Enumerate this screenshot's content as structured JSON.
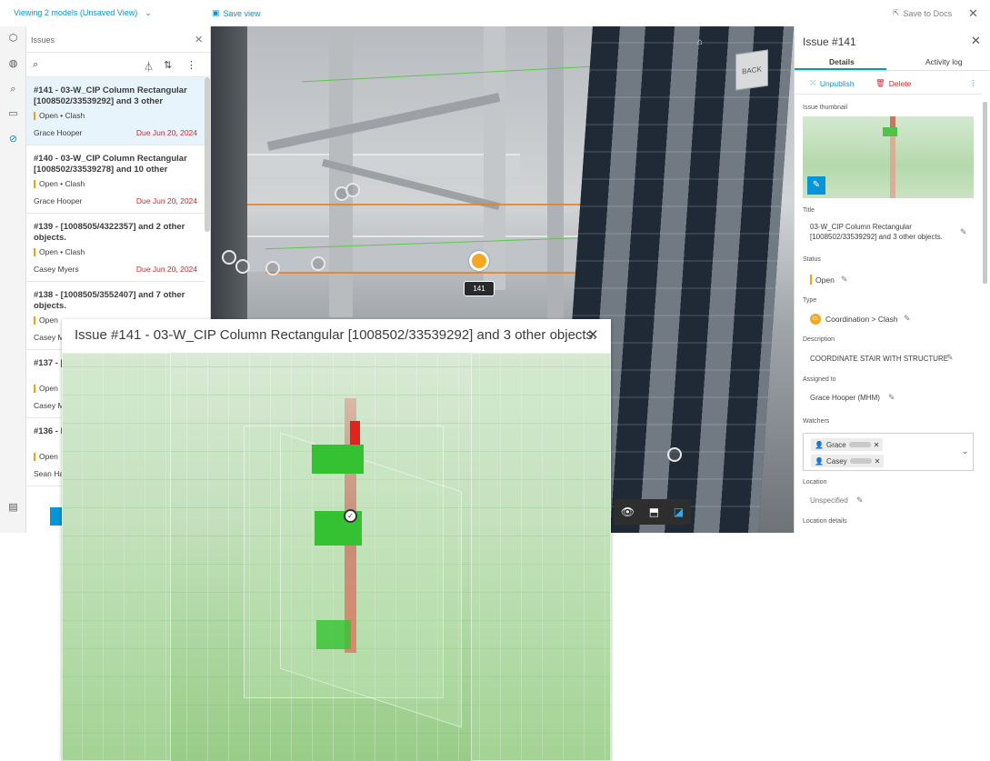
{
  "topbar": {
    "models_label": "Viewing 2 models (Unsaved View)",
    "save_view_label": "Save view",
    "save_docs_label": "Save to Docs"
  },
  "issues_panel": {
    "title": "Issues",
    "items": [
      {
        "title": "#141 - 03-W_CIP Column Rectangular [1008502/33539292] and 3 other objects.",
        "status": "Open • Clash",
        "assignee": "Grace Hooper",
        "due": "Due Jun 20, 2024"
      },
      {
        "title": "#140 - 03-W_CIP Column Rectangular [1008502/33539278] and 10 other objects.",
        "status": "Open • Clash",
        "assignee": "Grace Hooper",
        "due": "Due Jun 20, 2024"
      },
      {
        "title": "#139 - [1008505/4322357] and 2 other objects.",
        "status": "Open • Clash",
        "assignee": "Casey Myers",
        "due": "Due Jun 20, 2024"
      },
      {
        "title": "#138 - [1008505/3552407] and 7 other objects.",
        "status": "Open",
        "assignee": "Casey M",
        "due": ""
      },
      {
        "title": "#137 - [ objects",
        "status": "Open",
        "assignee": "Casey M",
        "due": ""
      },
      {
        "title": "#136 - Rectan",
        "status": "Open",
        "assignee": "Sean Ha",
        "due": ""
      }
    ]
  },
  "viewer": {
    "pin_label": "141",
    "viewcube_label": "BACK"
  },
  "details": {
    "title": "Issue #141",
    "tabs": [
      "Details",
      "Activity log"
    ],
    "unpublish_label": "Unpublish",
    "delete_label": "Delete",
    "thumbnail_label": "Issue thumbnail",
    "title_label": "Title",
    "title_value": "03-W_CIP Column Rectangular [1008502/33539292] and 3 other objects.",
    "status_label": "Status",
    "status_value": "Open",
    "type_label": "Type",
    "type_badge": "CL",
    "type_value": "Coordination > Clash",
    "description_label": "Description",
    "description_value": "COORDINATE STAIR WITH STRUCTURE",
    "assigned_label": "Assigned to",
    "assigned_value": "Grace Hooper (MHM)",
    "watchers_label": "Watchers",
    "watchers": [
      "Grace",
      "Casey"
    ],
    "location_label": "Location",
    "location_value": "Unspecified",
    "location_details_label": "Location details"
  },
  "popup": {
    "title": "Issue #141 - 03-W_CIP Column Rectangular [1008502/33539292] and 3 other objects."
  },
  "colors": {
    "accent": "#0696d7",
    "status_open": "#f0a30a",
    "due": "#d8282c",
    "delete": "#d8282c"
  }
}
